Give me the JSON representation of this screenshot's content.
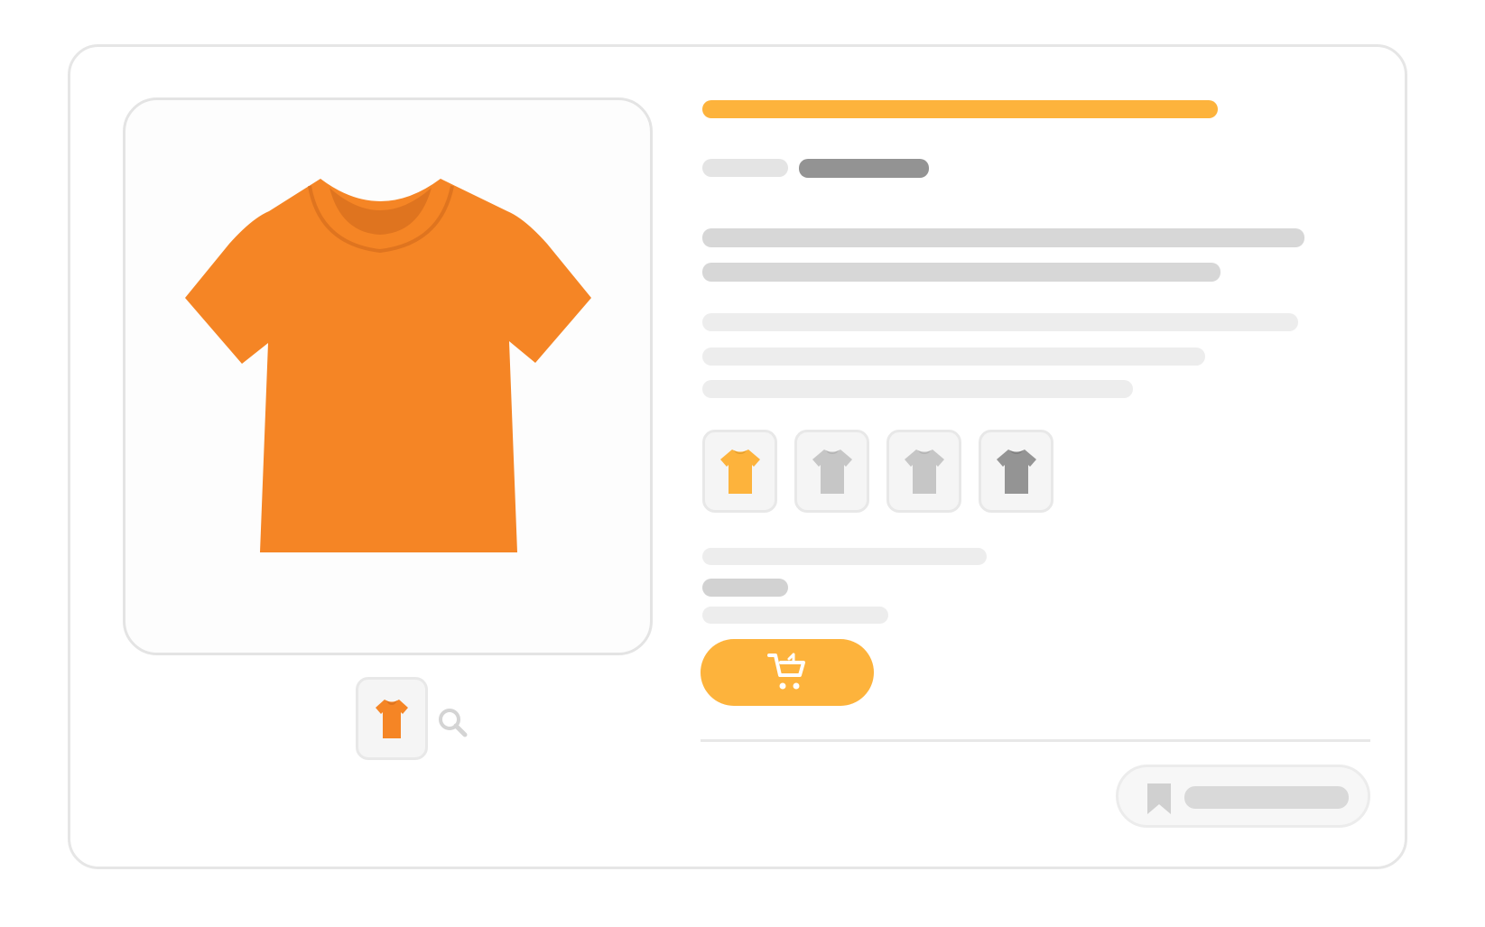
{
  "colors": {
    "accent": "#fdb33c",
    "product_orange": "#f58525",
    "collar_shade": "#df741f",
    "skeleton_dark": "#939393",
    "skeleton_mid": "#d7d7d7",
    "skeleton_light": "#ededed"
  },
  "product_image": {
    "icon": "tshirt-icon",
    "color": "orange"
  },
  "gallery": {
    "thumbnail_icon": "tshirt-icon",
    "zoom_icon": "magnifier-icon"
  },
  "color_options": [
    {
      "icon": "tshirt-icon",
      "color": "#fdb33c",
      "selected": true
    },
    {
      "icon": "tshirt-icon",
      "color": "#c6c6c6",
      "selected": false
    },
    {
      "icon": "tshirt-icon",
      "color": "#c6c6c6",
      "selected": false
    },
    {
      "icon": "tshirt-icon",
      "color": "#949494",
      "selected": false
    }
  ],
  "add_to_cart": {
    "icon": "cart-icon"
  },
  "wishlist": {
    "icon": "bookmark-icon"
  }
}
